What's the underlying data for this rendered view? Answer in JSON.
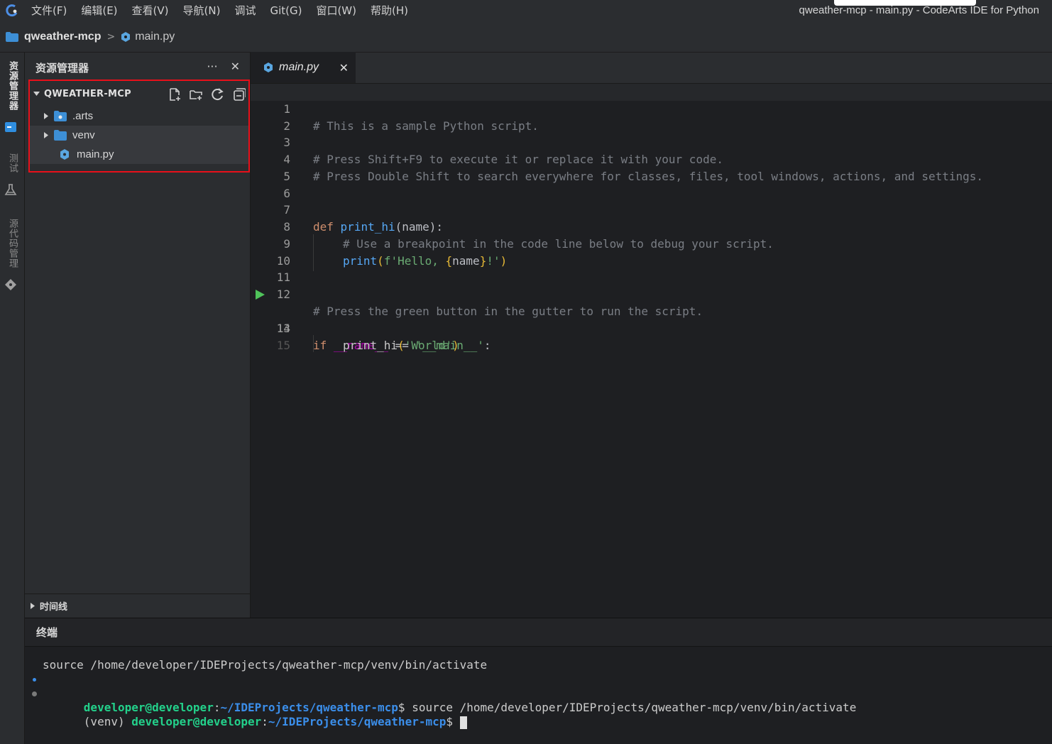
{
  "menubar": {
    "items": [
      "文件(F)",
      "编辑(E)",
      "查看(V)",
      "导航(N)",
      "调试",
      "Git(G)",
      "窗口(W)",
      "帮助(H)"
    ],
    "window_title": "qweather-mcp - main.py - CodeArts IDE for Python"
  },
  "breadcrumb": {
    "project": "qweather-mcp",
    "separator": ">",
    "file": "main.py"
  },
  "activitybar": {
    "explorer_label": "资源管理器",
    "test_label": "测试",
    "scm_label": "源代码管理"
  },
  "sidebar": {
    "title": "资源管理器",
    "more_label": "···",
    "close_label": "✕",
    "section_title": "QWEATHER-MCP",
    "tree": [
      {
        "name": ".arts",
        "type": "folder-special"
      },
      {
        "name": "venv",
        "type": "folder"
      },
      {
        "name": "main.py",
        "type": "python"
      }
    ],
    "timeline_title": "时间线"
  },
  "editor": {
    "tab_label": "main.py",
    "tab_close": "✕",
    "lines": [
      "1",
      "2",
      "3",
      "4",
      "5",
      "6",
      "7",
      "8",
      "9",
      "10",
      "11",
      "12",
      "13",
      "14",
      "15"
    ],
    "code": {
      "l1": "# This is a sample Python script.",
      "l3": "# Press Shift+F9 to execute it or replace it with your code.",
      "l4": "# Press Double Shift to search everywhere for classes, files, tool windows, actions, and settings.",
      "l7_kw": "def",
      "l7_fn": "print_hi",
      "l7_rest": "(name):",
      "l8": "# Use a breakpoint in the code line below to debug your script.",
      "l9_fn": "print",
      "l9_open": "(",
      "l9_str1": "f'Hello, ",
      "l9_br_open": "{",
      "l9_var": "name",
      "l9_br_close": "}",
      "l9_str2": "!'",
      "l9_close": ")",
      "l12": "# Press the green button in the gutter to run the script.",
      "l13_kw": "if",
      "l13_dn": "__name__",
      "l13_op": " == ",
      "l13_str": "'__main__'",
      "l13_colon": ":",
      "l14_fn": "print_hi",
      "l14_open": "(",
      "l14_str": "'World'",
      "l14_close": ")"
    }
  },
  "terminal": {
    "title": "终端",
    "line1": "source /home/developer/IDEProjects/qweather-mcp/venv/bin/activate",
    "line2_user": "developer@developer",
    "line2_colon": ":",
    "line2_path": "~/IDEProjects/qweather-mcp",
    "line2_cmd": "$ source /home/developer/IDEProjects/qweather-mcp/venv/bin/activate",
    "line3_prefix": "(venv) ",
    "line3_user": "developer@developer",
    "line3_colon": ":",
    "line3_path": "~/IDEProjects/qweather-mcp",
    "line3_prompt": "$ "
  },
  "colors": {
    "highlight_border": "#e8101a",
    "run_arrow": "#4fc35a",
    "terminal_green": "#23d18b",
    "terminal_blue": "#3b8eea"
  }
}
